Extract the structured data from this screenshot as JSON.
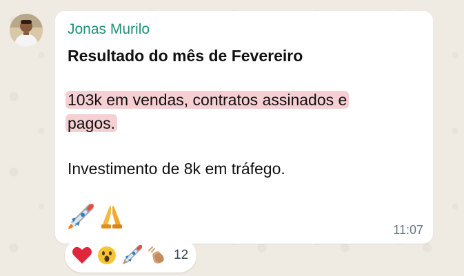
{
  "message": {
    "sender": "Jonas Murilo",
    "title": "Resultado do mês de Fevereiro",
    "highlight_line1": "103k em vendas, contratos assinados e",
    "highlight_line2": "pagos.",
    "investment": "Investimento de 8k em tráfego.",
    "emojis": [
      "rocket-emoji",
      "folded-hands-emoji"
    ],
    "time": "11:07"
  },
  "reactions": {
    "icons": [
      "heart-emoji",
      "surprised-face-emoji",
      "rocket-emoji",
      "clapping-hands-emoji"
    ],
    "count": "12"
  },
  "colors": {
    "sender": "#1f8f76",
    "highlight": "#f6cfd3",
    "background": "#efeae2"
  }
}
